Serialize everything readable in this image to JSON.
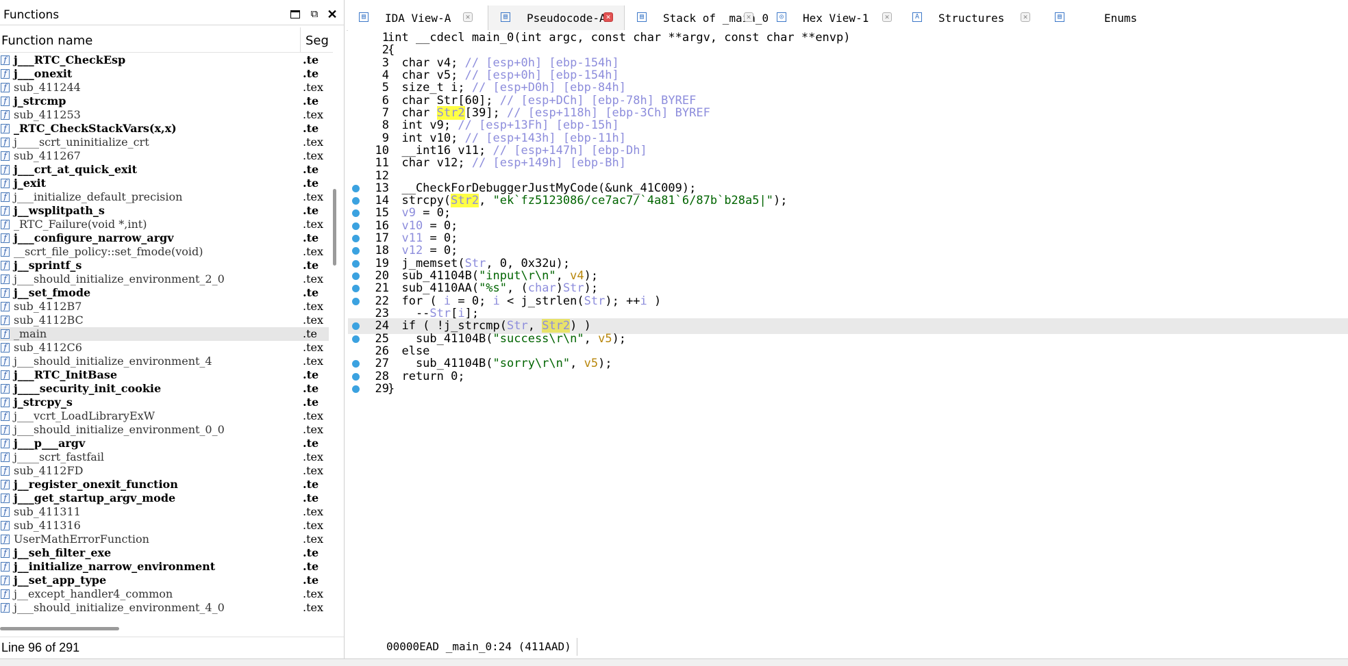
{
  "functions_panel": {
    "title": "Functions",
    "col_name": "Function name",
    "col_seg": "Seg",
    "status": "Line 96 of 291",
    "items": [
      {
        "name": "j___RTC_CheckEsp",
        "bold": true,
        "seg": ".te"
      },
      {
        "name": "j___onexit",
        "bold": true,
        "seg": ".te"
      },
      {
        "name": "sub_411244",
        "bold": false,
        "seg": ".tex"
      },
      {
        "name": "j_strcmp",
        "bold": true,
        "seg": ".te"
      },
      {
        "name": "sub_411253",
        "bold": false,
        "seg": ".tex"
      },
      {
        "name": "_RTC_CheckStackVars(x,x)",
        "bold": true,
        "seg": ".te"
      },
      {
        "name": "j____scrt_uninitialize_crt",
        "bold": false,
        "seg": ".tex"
      },
      {
        "name": "sub_411267",
        "bold": false,
        "seg": ".tex"
      },
      {
        "name": "j___crt_at_quick_exit",
        "bold": true,
        "seg": ".te"
      },
      {
        "name": "j_exit",
        "bold": true,
        "seg": ".te"
      },
      {
        "name": "j___initialize_default_precision",
        "bold": false,
        "seg": ".tex"
      },
      {
        "name": "j__wsplitpath_s",
        "bold": true,
        "seg": ".te"
      },
      {
        "name": "_RTC_Failure(void *,int)",
        "bold": false,
        "seg": ".tex"
      },
      {
        "name": "j___configure_narrow_argv",
        "bold": true,
        "seg": ".te"
      },
      {
        "name": "__scrt_file_policy::set_fmode(void)",
        "bold": false,
        "seg": ".tex"
      },
      {
        "name": "j__sprintf_s",
        "bold": true,
        "seg": ".te"
      },
      {
        "name": "j___should_initialize_environment_2_0",
        "bold": false,
        "seg": ".tex"
      },
      {
        "name": "j__set_fmode",
        "bold": true,
        "seg": ".te"
      },
      {
        "name": "sub_4112B7",
        "bold": false,
        "seg": ".tex"
      },
      {
        "name": "sub_4112BC",
        "bold": false,
        "seg": ".tex"
      },
      {
        "name": "_main",
        "bold": false,
        "seg": ".te",
        "selected": true
      },
      {
        "name": "sub_4112C6",
        "bold": false,
        "seg": ".tex"
      },
      {
        "name": "j___should_initialize_environment_4",
        "bold": false,
        "seg": ".tex"
      },
      {
        "name": "j___RTC_InitBase",
        "bold": true,
        "seg": ".te"
      },
      {
        "name": "j____security_init_cookie",
        "bold": true,
        "seg": ".te"
      },
      {
        "name": "j_strcpy_s",
        "bold": true,
        "seg": ".te"
      },
      {
        "name": "j___vcrt_LoadLibraryExW",
        "bold": false,
        "seg": ".tex"
      },
      {
        "name": "j___should_initialize_environment_0_0",
        "bold": false,
        "seg": ".tex"
      },
      {
        "name": "j___p___argv",
        "bold": true,
        "seg": ".te"
      },
      {
        "name": "j____scrt_fastfail",
        "bold": false,
        "seg": ".tex"
      },
      {
        "name": "sub_4112FD",
        "bold": false,
        "seg": ".tex"
      },
      {
        "name": "j__register_onexit_function",
        "bold": true,
        "seg": ".te"
      },
      {
        "name": "j___get_startup_argv_mode",
        "bold": true,
        "seg": ".te"
      },
      {
        "name": "sub_411311",
        "bold": false,
        "seg": ".tex"
      },
      {
        "name": "sub_411316",
        "bold": false,
        "seg": ".tex"
      },
      {
        "name": "UserMathErrorFunction",
        "bold": false,
        "seg": ".tex"
      },
      {
        "name": "j__seh_filter_exe",
        "bold": true,
        "seg": ".te"
      },
      {
        "name": "j__initialize_narrow_environment",
        "bold": true,
        "seg": ".te"
      },
      {
        "name": "j__set_app_type",
        "bold": true,
        "seg": ".te"
      },
      {
        "name": "j__except_handler4_common",
        "bold": false,
        "seg": ".tex"
      },
      {
        "name": "j___should_initialize_environment_4_0",
        "bold": false,
        "seg": ".tex"
      }
    ]
  },
  "tabs": [
    {
      "label": "IDA View-A",
      "icon": "ida-view-icon",
      "active": false
    },
    {
      "label": "Pseudocode-A",
      "icon": "pseudocode-icon",
      "active": true
    },
    {
      "label": "Stack of _main_0",
      "icon": "stack-icon",
      "active": false
    },
    {
      "label": "Hex View-1",
      "icon": "hex-view-icon",
      "active": false
    },
    {
      "label": "Structures",
      "icon": "structures-icon",
      "active": false
    },
    {
      "label": "Enums",
      "icon": "enums-icon",
      "active": false
    }
  ],
  "code": {
    "lines": [
      {
        "n": "1",
        "bp": false,
        "cur": false,
        "t": [
          [
            "int __cdecl main_0(int argc, const char **argv, const char **envp)",
            "k"
          ]
        ]
      },
      {
        "n": "2",
        "bp": false,
        "cur": false,
        "t": [
          [
            "{",
            "k"
          ]
        ]
      },
      {
        "n": "3",
        "bp": false,
        "cur": false,
        "t": [
          [
            "  char v4; ",
            "k"
          ],
          [
            "// [esp+0h] [ebp-154h]",
            "c"
          ]
        ]
      },
      {
        "n": "4",
        "bp": false,
        "cur": false,
        "t": [
          [
            "  char v5; ",
            "k"
          ],
          [
            "// [esp+0h] [ebp-154h]",
            "c"
          ]
        ]
      },
      {
        "n": "5",
        "bp": false,
        "cur": false,
        "t": [
          [
            "  size_t i; ",
            "k"
          ],
          [
            "// [esp+D0h] [ebp-84h]",
            "c"
          ]
        ]
      },
      {
        "n": "6",
        "bp": false,
        "cur": false,
        "t": [
          [
            "  char Str[60]; ",
            "k"
          ],
          [
            "// [esp+DCh] [ebp-78h] BYREF",
            "c"
          ]
        ]
      },
      {
        "n": "7",
        "bp": false,
        "cur": false,
        "t": [
          [
            "  char ",
            "k"
          ],
          [
            "Str2",
            "hl"
          ],
          [
            "[39]; ",
            "k"
          ],
          [
            "// [esp+118h] [ebp-3Ch] BYREF",
            "c"
          ]
        ]
      },
      {
        "n": "8",
        "bp": false,
        "cur": false,
        "t": [
          [
            "  int v9; ",
            "k"
          ],
          [
            "// [esp+13Fh] [ebp-15h]",
            "c"
          ]
        ]
      },
      {
        "n": "9",
        "bp": false,
        "cur": false,
        "t": [
          [
            "  int v10; ",
            "k"
          ],
          [
            "// [esp+143h] [ebp-11h]",
            "c"
          ]
        ]
      },
      {
        "n": "10",
        "bp": false,
        "cur": false,
        "t": [
          [
            "  __int16 v11; ",
            "k"
          ],
          [
            "// [esp+147h] [ebp-Dh]",
            "c"
          ]
        ]
      },
      {
        "n": "11",
        "bp": false,
        "cur": false,
        "t": [
          [
            "  char v12; ",
            "k"
          ],
          [
            "// [esp+149h] [ebp-Bh]",
            "c"
          ]
        ]
      },
      {
        "n": "12",
        "bp": false,
        "cur": false,
        "t": [
          [
            "",
            "k"
          ]
        ]
      },
      {
        "n": "13",
        "bp": true,
        "cur": false,
        "t": [
          [
            "  __CheckForDebuggerJustMyCode(&unk_41C009);",
            "k"
          ]
        ]
      },
      {
        "n": "14",
        "bp": true,
        "cur": false,
        "t": [
          [
            "  strcpy(",
            "k"
          ],
          [
            "Str2",
            "hl"
          ],
          [
            ", ",
            "k"
          ],
          [
            "\"ek`fz5123086/ce7ac7/`4a81`6/87b`b28a5|\"",
            "s"
          ],
          [
            ");",
            "k"
          ]
        ]
      },
      {
        "n": "15",
        "bp": true,
        "cur": false,
        "t": [
          [
            "  ",
            "k"
          ],
          [
            "v9",
            "v"
          ],
          [
            " = 0;",
            "k"
          ]
        ]
      },
      {
        "n": "16",
        "bp": true,
        "cur": false,
        "t": [
          [
            "  ",
            "k"
          ],
          [
            "v10",
            "v"
          ],
          [
            " = 0;",
            "k"
          ]
        ]
      },
      {
        "n": "17",
        "bp": true,
        "cur": false,
        "t": [
          [
            "  ",
            "k"
          ],
          [
            "v11",
            "v"
          ],
          [
            " = 0;",
            "k"
          ]
        ]
      },
      {
        "n": "18",
        "bp": true,
        "cur": false,
        "t": [
          [
            "  ",
            "k"
          ],
          [
            "v12",
            "v"
          ],
          [
            " = 0;",
            "k"
          ]
        ]
      },
      {
        "n": "19",
        "bp": true,
        "cur": false,
        "t": [
          [
            "  j_memset(",
            "k"
          ],
          [
            "Str",
            "v"
          ],
          [
            ", 0, 0x32u);",
            "k"
          ]
        ]
      },
      {
        "n": "20",
        "bp": true,
        "cur": false,
        "t": [
          [
            "  sub_41104B(",
            "k"
          ],
          [
            "\"input\\r\\n\"",
            "s"
          ],
          [
            ", ",
            "k"
          ],
          [
            "v4",
            "o"
          ],
          [
            ");",
            "k"
          ]
        ]
      },
      {
        "n": "21",
        "bp": true,
        "cur": false,
        "t": [
          [
            "  sub_4110AA(",
            "k"
          ],
          [
            "\"%s\"",
            "s"
          ],
          [
            ", (",
            "k"
          ],
          [
            "char",
            "v"
          ],
          [
            ")",
            "k"
          ],
          [
            "Str",
            "v"
          ],
          [
            ");",
            "k"
          ]
        ]
      },
      {
        "n": "22",
        "bp": true,
        "cur": false,
        "t": [
          [
            "  for ( ",
            "k"
          ],
          [
            "i",
            "v"
          ],
          [
            " = 0; ",
            "k"
          ],
          [
            "i",
            "v"
          ],
          [
            " < j_strlen(",
            "k"
          ],
          [
            "Str",
            "v"
          ],
          [
            "); ++",
            "k"
          ],
          [
            "i",
            "v"
          ],
          [
            " )",
            "k"
          ]
        ]
      },
      {
        "n": "23",
        "bp": false,
        "cur": false,
        "t": [
          [
            "    --",
            "k"
          ],
          [
            "Str",
            "v"
          ],
          [
            "[",
            "k"
          ],
          [
            "i",
            "v"
          ],
          [
            "];",
            "k"
          ]
        ]
      },
      {
        "n": "24",
        "bp": true,
        "cur": true,
        "t": [
          [
            "  if ( !j_strcmp(",
            "k"
          ],
          [
            "Str",
            "v"
          ],
          [
            ", ",
            "k"
          ],
          [
            "Str2",
            "hlsel"
          ],
          [
            ") )",
            "k"
          ]
        ]
      },
      {
        "n": "25",
        "bp": true,
        "cur": false,
        "t": [
          [
            "    sub_41104B(",
            "k"
          ],
          [
            "\"success\\r\\n\"",
            "s"
          ],
          [
            ", ",
            "k"
          ],
          [
            "v5",
            "o"
          ],
          [
            ");",
            "k"
          ]
        ]
      },
      {
        "n": "26",
        "bp": false,
        "cur": false,
        "t": [
          [
            "  else",
            "k"
          ]
        ]
      },
      {
        "n": "27",
        "bp": true,
        "cur": false,
        "t": [
          [
            "    sub_41104B(",
            "k"
          ],
          [
            "\"sorry\\r\\n\"",
            "s"
          ],
          [
            ", ",
            "k"
          ],
          [
            "v5",
            "o"
          ],
          [
            ");",
            "k"
          ]
        ]
      },
      {
        "n": "28",
        "bp": true,
        "cur": false,
        "t": [
          [
            "  return 0;",
            "k"
          ]
        ]
      },
      {
        "n": "29",
        "bp": true,
        "cur": false,
        "t": [
          [
            "}",
            "k"
          ]
        ]
      }
    ],
    "status": "00000EAD _main_0:24 (411AAD)"
  },
  "colors": {
    "comment": "#8d8ddc",
    "string": "#006400",
    "local_var": "#b8860b",
    "highlight": "#ffff44",
    "breakpoint": "#3ba2e0",
    "close_active": "#e25252"
  }
}
